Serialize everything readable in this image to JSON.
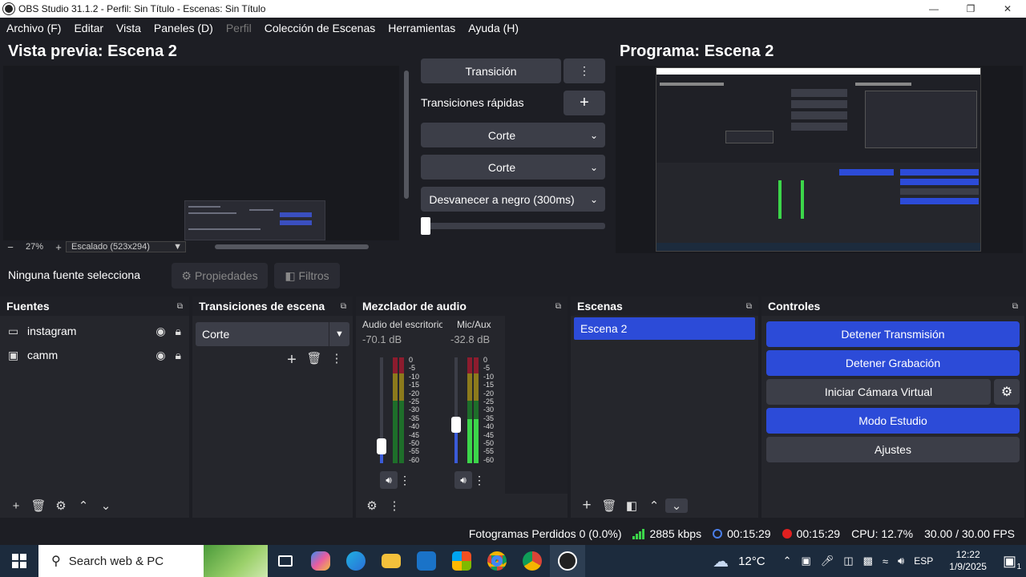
{
  "window": {
    "title": "OBS Studio 31.1.2 - Perfil: Sin Título - Escenas: Sin Título"
  },
  "menu": [
    "Archivo (F)",
    "Editar",
    "Vista",
    "Paneles (D)",
    "Perfil",
    "Colección de Escenas",
    "Herramientas",
    "Ayuda (H)"
  ],
  "preview": {
    "title": "Vista previa: Escena 2",
    "zoom": "27%",
    "scale_mode": "Escalado (523x294)"
  },
  "program": {
    "title": "Programa: Escena 2"
  },
  "transitions_panel": {
    "transition_label": "Transición",
    "quick_label": "Transiciones rápidas",
    "drop1": "Corte",
    "drop2": "Corte",
    "drop3": "Desvanecer a negro (300ms)",
    "slider_value": 0
  },
  "source_bar": {
    "no_source": "Ninguna fuente selecciona",
    "properties": "Propiedades",
    "filters": "Filtros"
  },
  "docks": {
    "sources": {
      "title": "Fuentes",
      "items": [
        {
          "name": "instagram",
          "icon": "monitor-icon"
        },
        {
          "name": "camm",
          "icon": "camera-icon"
        }
      ]
    },
    "scene_transitions": {
      "title": "Transiciones de escena",
      "selected": "Corte"
    },
    "mixer": {
      "title": "Mezclador de audio",
      "channels": [
        {
          "name": "Audio del escritorio",
          "db": "-70.1 dB",
          "fader": 0.16,
          "level": 0.0
        },
        {
          "name": "Mic/Aux",
          "db": "-32.8 dB",
          "fader": 0.36,
          "level": 0.42
        }
      ],
      "scale": [
        "0",
        "-5",
        "-10",
        "-15",
        "-20",
        "-25",
        "-30",
        "-35",
        "-40",
        "-45",
        "-50",
        "-55",
        "-60"
      ]
    },
    "scenes": {
      "title": "Escenas",
      "items": [
        "Escena 2"
      ]
    },
    "controls": {
      "title": "Controles",
      "stop_stream": "Detener Transmisión",
      "stop_record": "Detener Grabación",
      "virtual_cam": "Iniciar Cámara Virtual",
      "studio_mode": "Modo Estudio",
      "settings": "Ajustes"
    }
  },
  "status": {
    "dropped": "Fotogramas Perdidos 0 (0.0%)",
    "bitrate": "2885 kbps",
    "stream_time": "00:15:29",
    "record_time": "00:15:29",
    "cpu": "CPU: 12.7%",
    "fps": "30.00 / 30.00 FPS"
  },
  "taskbar": {
    "search_placeholder": "Search web & PC",
    "weather": "12°C",
    "lang": "ESP",
    "time": "12:22",
    "date": "1/9/2025",
    "notif_count": "1"
  },
  "colors": {
    "accent": "#2c4bd8",
    "bg": "#1d1e24",
    "panel": "#25262c",
    "button": "#3c3e48"
  }
}
